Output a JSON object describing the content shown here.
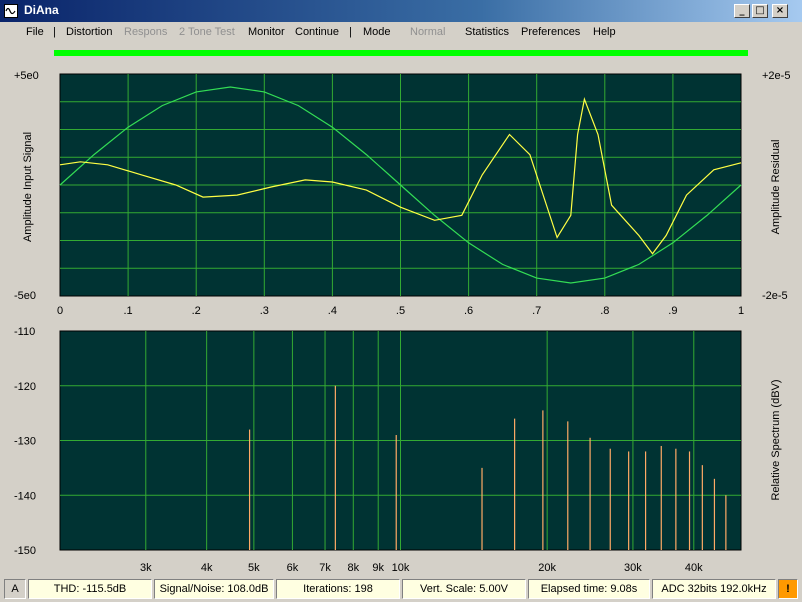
{
  "window": {
    "title": "DiAna"
  },
  "menu": [
    {
      "label": "File",
      "enabled": true
    },
    {
      "label": "|",
      "enabled": true
    },
    {
      "label": "Distortion",
      "enabled": true
    },
    {
      "label": "Respons",
      "enabled": false
    },
    {
      "label": "2 Tone Test",
      "enabled": false
    },
    {
      "label": "Monitor",
      "enabled": true
    },
    {
      "label": "Continue",
      "enabled": true
    },
    {
      "label": "|",
      "enabled": true
    },
    {
      "label": "Mode",
      "enabled": true
    },
    {
      "label": "Normal",
      "enabled": false
    },
    {
      "label": "Statistics",
      "enabled": true
    },
    {
      "label": "Preferences",
      "enabled": true
    },
    {
      "label": "Help",
      "enabled": true
    }
  ],
  "colors": {
    "plot_bg": "#003333",
    "grid": "#33aa33",
    "input_trace": "#33dd55",
    "residual_trace": "#ffff44",
    "spectrum_bar": "#ffaa66",
    "progress": "#00ff00"
  },
  "top_plot": {
    "left_label": "Amplitude Input Signal",
    "right_label": "Amplitude Residual",
    "left_top": "+5e0",
    "left_bottom": "-5e0",
    "right_top": "+2e-5",
    "right_bottom": "-2e-5",
    "x_ticks": [
      "0",
      ".1",
      ".2",
      ".3",
      ".4",
      ".5",
      ".6",
      ".7",
      ".8",
      ".9",
      "1"
    ],
    "input_y": [
      0.0,
      0.31,
      0.59,
      0.81,
      0.95,
      1.0,
      0.95,
      0.81,
      0.59,
      0.31,
      0.0,
      -0.31,
      -0.59,
      -0.81,
      -0.95,
      -1.0,
      -0.95,
      -0.81,
      -0.59,
      -0.31,
      0.0
    ],
    "residual_t": [
      0.0,
      0.03,
      0.07,
      0.12,
      0.17,
      0.21,
      0.26,
      0.31,
      0.36,
      0.4,
      0.45,
      0.5,
      0.55,
      0.59,
      0.62,
      0.66,
      0.69,
      0.73,
      0.75,
      0.76,
      0.77,
      0.79,
      0.81,
      0.83,
      0.85,
      0.87,
      0.89,
      0.92,
      0.96,
      1.0
    ],
    "residual_y": [
      0.2,
      0.23,
      0.2,
      0.1,
      0.0,
      -0.12,
      -0.1,
      -0.02,
      0.05,
      0.03,
      -0.05,
      -0.22,
      -0.35,
      -0.3,
      0.1,
      0.5,
      0.3,
      -0.52,
      -0.3,
      0.5,
      0.85,
      0.5,
      -0.2,
      -0.35,
      -0.5,
      -0.68,
      -0.5,
      -0.1,
      0.15,
      0.22
    ]
  },
  "bottom_plot": {
    "right_label": "Relative Spectrum (dBV)",
    "y_ticks": [
      "-110",
      "-120",
      "-130",
      "-140",
      "-150"
    ],
    "y_range": [
      -150,
      -110
    ],
    "x_ticks": [
      "3k",
      "4k",
      "5k",
      "6k",
      "7k",
      "8k",
      "9k",
      "10k",
      "20k",
      "30k",
      "40k"
    ],
    "x_tick_values": [
      3000,
      4000,
      5000,
      6000,
      7000,
      8000,
      9000,
      10000,
      20000,
      30000,
      40000
    ],
    "x_range": [
      2000,
      50000
    ],
    "bars_freq": [
      4900,
      7350,
      9800,
      14700,
      17150,
      19600,
      22050,
      24500,
      26950,
      29400,
      31850,
      34300,
      36750,
      39200,
      41650,
      44100,
      46550
    ],
    "bars_db": [
      -128.0,
      -120.0,
      -129.0,
      -135.0,
      -126.0,
      -124.5,
      -126.5,
      -129.5,
      -131.5,
      -132.0,
      -132.0,
      -131.0,
      -131.5,
      -132.0,
      -134.5,
      -137.0,
      -140.0
    ]
  },
  "status": {
    "mode": "A",
    "thd": "THD: -115.5dB",
    "snr": "Signal/Noise:  108.0dB",
    "iterations": "Iterations: 198",
    "vscale": "Vert. Scale: 5.00V",
    "elapsed": "Elapsed time: 9.08s",
    "adc": "ADC 32bits 192.0kHz",
    "warn": "!"
  }
}
